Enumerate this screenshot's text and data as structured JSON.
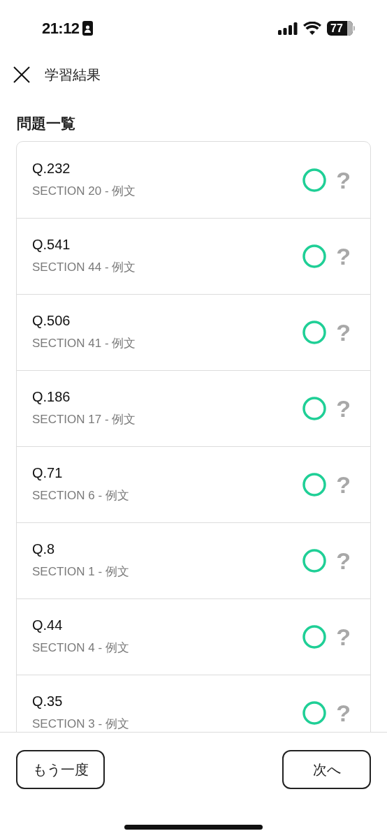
{
  "status_bar": {
    "time": "21:12",
    "battery": "77"
  },
  "header": {
    "title": "学習結果"
  },
  "section_title": "問題一覧",
  "questions": [
    {
      "number": "Q.232",
      "section": "SECTION 20 - 例文",
      "kind": "correct",
      "hint_mark": "?"
    },
    {
      "number": "Q.541",
      "section": "SECTION 44 - 例文",
      "kind": "correct",
      "hint_mark": "?"
    },
    {
      "number": "Q.506",
      "section": "SECTION 41 - 例文",
      "kind": "correct",
      "hint_mark": "?"
    },
    {
      "number": "Q.186",
      "section": "SECTION 17 - 例文",
      "kind": "correct",
      "hint_mark": "?"
    },
    {
      "number": "Q.71",
      "section": "SECTION 6 - 例文",
      "kind": "correct",
      "hint_mark": "?"
    },
    {
      "number": "Q.8",
      "section": "SECTION 1 - 例文",
      "kind": "correct",
      "hint_mark": "?"
    },
    {
      "number": "Q.44",
      "section": "SECTION 4 - 例文",
      "kind": "correct",
      "hint_mark": "?"
    },
    {
      "number": "Q.35",
      "section": "SECTION 3 - 例文",
      "kind": "correct",
      "hint_mark": "?"
    }
  ],
  "buttons": {
    "retry": "もう一度",
    "next": "次へ"
  }
}
